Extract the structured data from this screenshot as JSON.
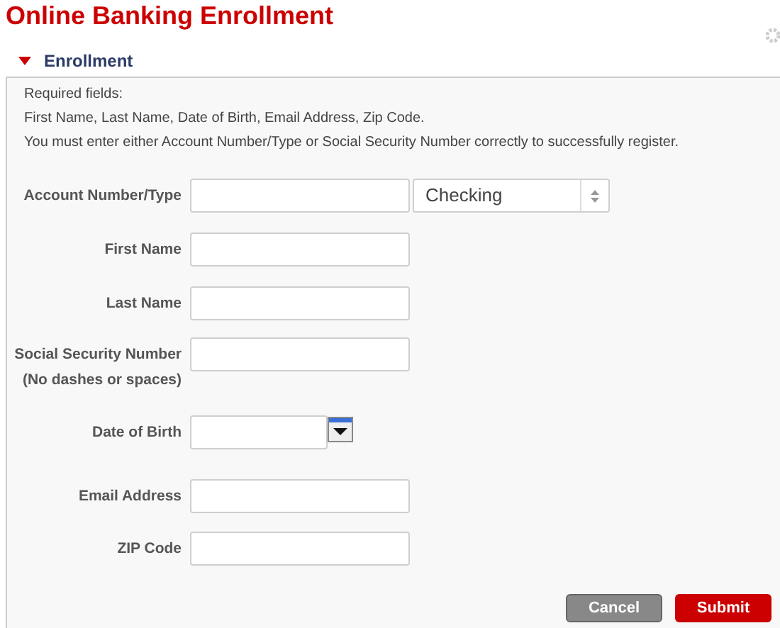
{
  "title": "Online Banking Enrollment",
  "section": {
    "label": "Enrollment",
    "expanded": true
  },
  "notes": [
    "Required fields:",
    "First Name, Last Name, Date of Birth, Email Address, Zip Code.",
    "You must enter either Account Number/Type or Social Security Number correctly to successfully register."
  ],
  "fields": [
    {
      "kind": "account",
      "label": "Account Number/Type",
      "select_value": "Checking"
    },
    {
      "kind": "text",
      "label": "First Name"
    },
    {
      "kind": "text",
      "label": "Last Name"
    },
    {
      "kind": "text",
      "label": "Social Security Number",
      "note": "(No dashes or spaces)"
    },
    {
      "kind": "date",
      "label": "Date of Birth"
    },
    {
      "kind": "text",
      "label": "Email Address"
    },
    {
      "kind": "text",
      "label": "ZIP Code"
    }
  ],
  "buttons": [
    {
      "kind": "secondary",
      "label": "Cancel"
    },
    {
      "kind": "primary",
      "label": "Submit"
    }
  ]
}
